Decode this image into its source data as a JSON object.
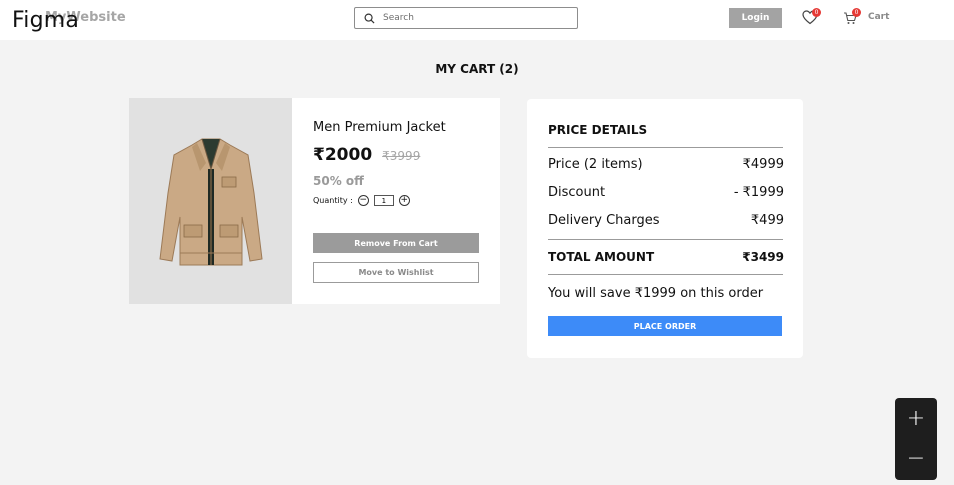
{
  "overlay": {
    "figma_label": "Figma"
  },
  "header": {
    "brand": "MyWebsite",
    "search": {
      "placeholder": "Search",
      "value": ""
    },
    "login_label": "Login",
    "wishlist_count": "0",
    "cart_count": "0",
    "cart_label": "Cart"
  },
  "page": {
    "title": "MY CART (2)"
  },
  "cart_item": {
    "name": "Men Premium Jacket",
    "price": "₹2000",
    "mrp": "₹3999",
    "discount": "50% off",
    "quantity_label": "Quantity :",
    "quantity_value": "1",
    "remove_label": "Remove From Cart",
    "wishlist_label": "Move to Wishlist"
  },
  "price_details": {
    "title": "PRICE DETAILS",
    "rows": [
      {
        "label": "Price (2 items)",
        "value": "₹4999"
      },
      {
        "label": "Discount",
        "value": "- ₹1999"
      },
      {
        "label": "Delivery Charges",
        "value": "₹499"
      }
    ],
    "total_label": "TOTAL AMOUNT",
    "total_value": "₹3499",
    "savings_text": "You will save ₹1999 on this order",
    "place_order_label": "PLACE ORDER"
  },
  "zoom_controls": {
    "zoom_in": "+",
    "zoom_out": "−"
  },
  "colors": {
    "accent": "#3d8bf8",
    "badge": "#e53935",
    "muted_button": "#9b9b9b",
    "background": "#f3f3f3"
  }
}
